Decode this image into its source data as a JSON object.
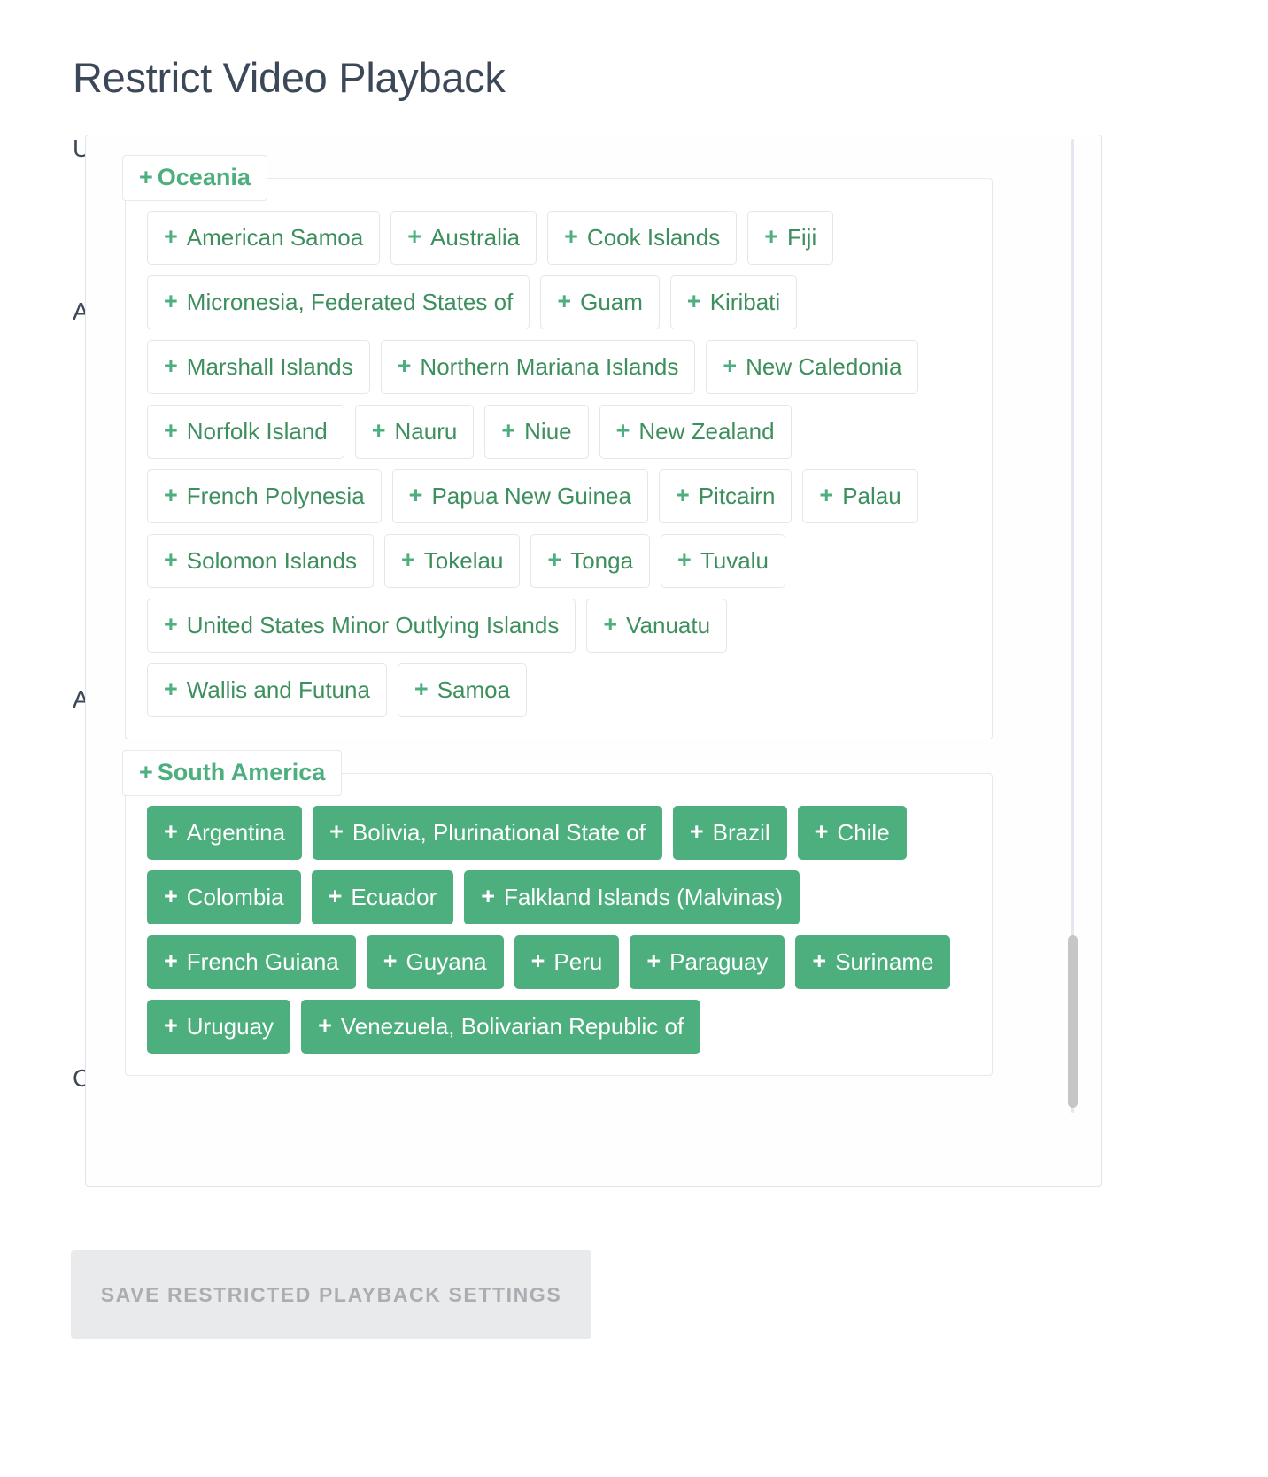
{
  "page": {
    "title": "Restrict Video Playback"
  },
  "background_form": {
    "label_1": "User Signed Embed Code",
    "label_2": "Allowed Domains",
    "label_3": "Allowed Countries",
    "label_4": "Countries"
  },
  "region_groups": [
    {
      "id": "oceania",
      "legend": "Oceania",
      "legend_plus": "+",
      "countries": [
        {
          "label": "American Samoa",
          "selected": false
        },
        {
          "label": "Australia",
          "selected": false
        },
        {
          "label": "Cook Islands",
          "selected": false
        },
        {
          "label": "Fiji",
          "selected": false
        },
        {
          "label": "Micronesia, Federated States of",
          "selected": false
        },
        {
          "label": "Guam",
          "selected": false
        },
        {
          "label": "Kiribati",
          "selected": false
        },
        {
          "label": "Marshall Islands",
          "selected": false
        },
        {
          "label": "Northern Mariana Islands",
          "selected": false
        },
        {
          "label": "New Caledonia",
          "selected": false
        },
        {
          "label": "Norfolk Island",
          "selected": false
        },
        {
          "label": "Nauru",
          "selected": false
        },
        {
          "label": "Niue",
          "selected": false
        },
        {
          "label": "New Zealand",
          "selected": false
        },
        {
          "label": "French Polynesia",
          "selected": false
        },
        {
          "label": "Papua New Guinea",
          "selected": false
        },
        {
          "label": "Pitcairn",
          "selected": false
        },
        {
          "label": "Palau",
          "selected": false
        },
        {
          "label": "Solomon Islands",
          "selected": false
        },
        {
          "label": "Tokelau",
          "selected": false
        },
        {
          "label": "Tonga",
          "selected": false
        },
        {
          "label": "Tuvalu",
          "selected": false
        },
        {
          "label": "United States Minor Outlying Islands",
          "selected": false
        },
        {
          "label": "Vanuatu",
          "selected": false
        },
        {
          "label": "Wallis and Futuna",
          "selected": false
        },
        {
          "label": "Samoa",
          "selected": false
        }
      ]
    },
    {
      "id": "south-america",
      "legend": "South America",
      "legend_plus": "+",
      "countries": [
        {
          "label": "Argentina",
          "selected": true
        },
        {
          "label": "Bolivia, Plurinational State of",
          "selected": true
        },
        {
          "label": "Brazil",
          "selected": true
        },
        {
          "label": "Chile",
          "selected": true
        },
        {
          "label": "Colombia",
          "selected": true
        },
        {
          "label": "Ecuador",
          "selected": true
        },
        {
          "label": "Falkland Islands (Malvinas)",
          "selected": true
        },
        {
          "label": "French Guiana",
          "selected": true
        },
        {
          "label": "Guyana",
          "selected": true
        },
        {
          "label": "Peru",
          "selected": true
        },
        {
          "label": "Paraguay",
          "selected": true
        },
        {
          "label": "Suriname",
          "selected": true
        },
        {
          "label": "Uruguay",
          "selected": true
        },
        {
          "label": "Venezuela, Bolivarian Republic of",
          "selected": true
        }
      ]
    }
  ],
  "tag_plus": "+",
  "footer": {
    "save_label": "Save Restricted Playback Settings"
  },
  "colors": {
    "accent_green": "#4caf7d",
    "tag_text_green": "#3e8f5e",
    "title_text": "#3c4858",
    "panel_border": "#dfe5ee",
    "tag_border": "#e4e6e9",
    "save_button_bg": "#e8eaec",
    "save_button_text": "#a9aeb3",
    "scrollbar_thumb": "#c6c6c6"
  }
}
